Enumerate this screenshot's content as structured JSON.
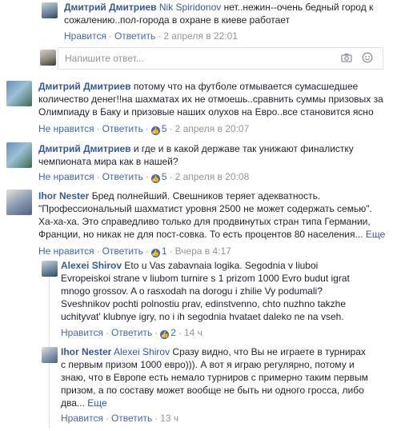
{
  "c1": {
    "author": "Дмитрий Дмитриев",
    "mention": "Nik Spiridonov",
    "lines": [
      "нет..нежин--очень бедный город к",
      "сожалению..пол-города в охране в киеве работает"
    ],
    "like": "Нравится",
    "reply": "Ответить",
    "time": "2 апреля в 22:01"
  },
  "reply_box": {
    "placeholder": "Напишите ответ...",
    "camera_icon": "camera-icon",
    "emoji_icon": "smile-icon"
  },
  "c2": {
    "author": "Дмитрий Дмитриев",
    "lines": [
      " потому что на футболе отмывается сумасшедшее",
      "количество денег!!на шахматах их не отмоешь..сравнить суммы призовых за",
      "Олимпиаду в Баку и призовые наших олухов на Евро..все становится ясно"
    ],
    "unlike": "Не нравится",
    "reply": "Ответить",
    "likes": "5",
    "time": "2 апреля в 20:07"
  },
  "c3": {
    "author": "Дмитрий Дмитриев",
    "lines": [
      " и где и в какой державе так унижают финалистку",
      "чемпионата мира как в нашей?"
    ],
    "unlike": "Не нравится",
    "reply": "Ответить",
    "likes": "5",
    "time": "2 апреля в 20:08"
  },
  "c4": {
    "author": "Ihor Nester",
    "lines": [
      " Бред полнейший. Свешников теряет адекватность.",
      "\"Профессиональный шахматист уровня 2500 не может содержать семью\".",
      "Ха-ха-ха. Это справедливо только для продвинутых стран типа Германии,",
      "Франции, но никак не для пост-совка. То есть процентов 80 населения..."
    ],
    "more": "Еще",
    "unlike": "Не нравится",
    "reply": "Ответить",
    "likes": "1",
    "time": "Вчера в 4:17"
  },
  "c5": {
    "author": "Alexei Shirov",
    "lines": [
      " Eto u Vas zabavnaia logika. Segodnia v liuboi",
      "Evropeiskoi strane v liubom turnire s 1 prizom 1000 Evro budut igrat",
      "mnogo grossov. A o rasxodah na dorogu i zhilie Vy podumali?",
      "Sveshnikov pochti polnostiu prav, edinstvenno, chto nuzhno takzhe",
      "uchityvat' klubnye igry, no i ih segodnia hvataet daleko ne na vseh."
    ],
    "like": "Нравится",
    "reply": "Ответить",
    "likes": "2",
    "time": "14 ч"
  },
  "c6": {
    "author": "Ihor Nester",
    "mention": "Alexei Shirov",
    "lines": [
      " Сразу видно, что Вы не играете в турнирах",
      "с первым призом 1000 евро))). А вот я играю регулярно, потому и",
      "знаю, что в Европе есть немало турниров с примерно таким первым",
      "призом, а по составу может вообще не быть ни одного гросса, либо",
      "два..."
    ],
    "more": "Еще",
    "like": "Нравится",
    "reply": "Ответить",
    "time": "13 ч"
  }
}
